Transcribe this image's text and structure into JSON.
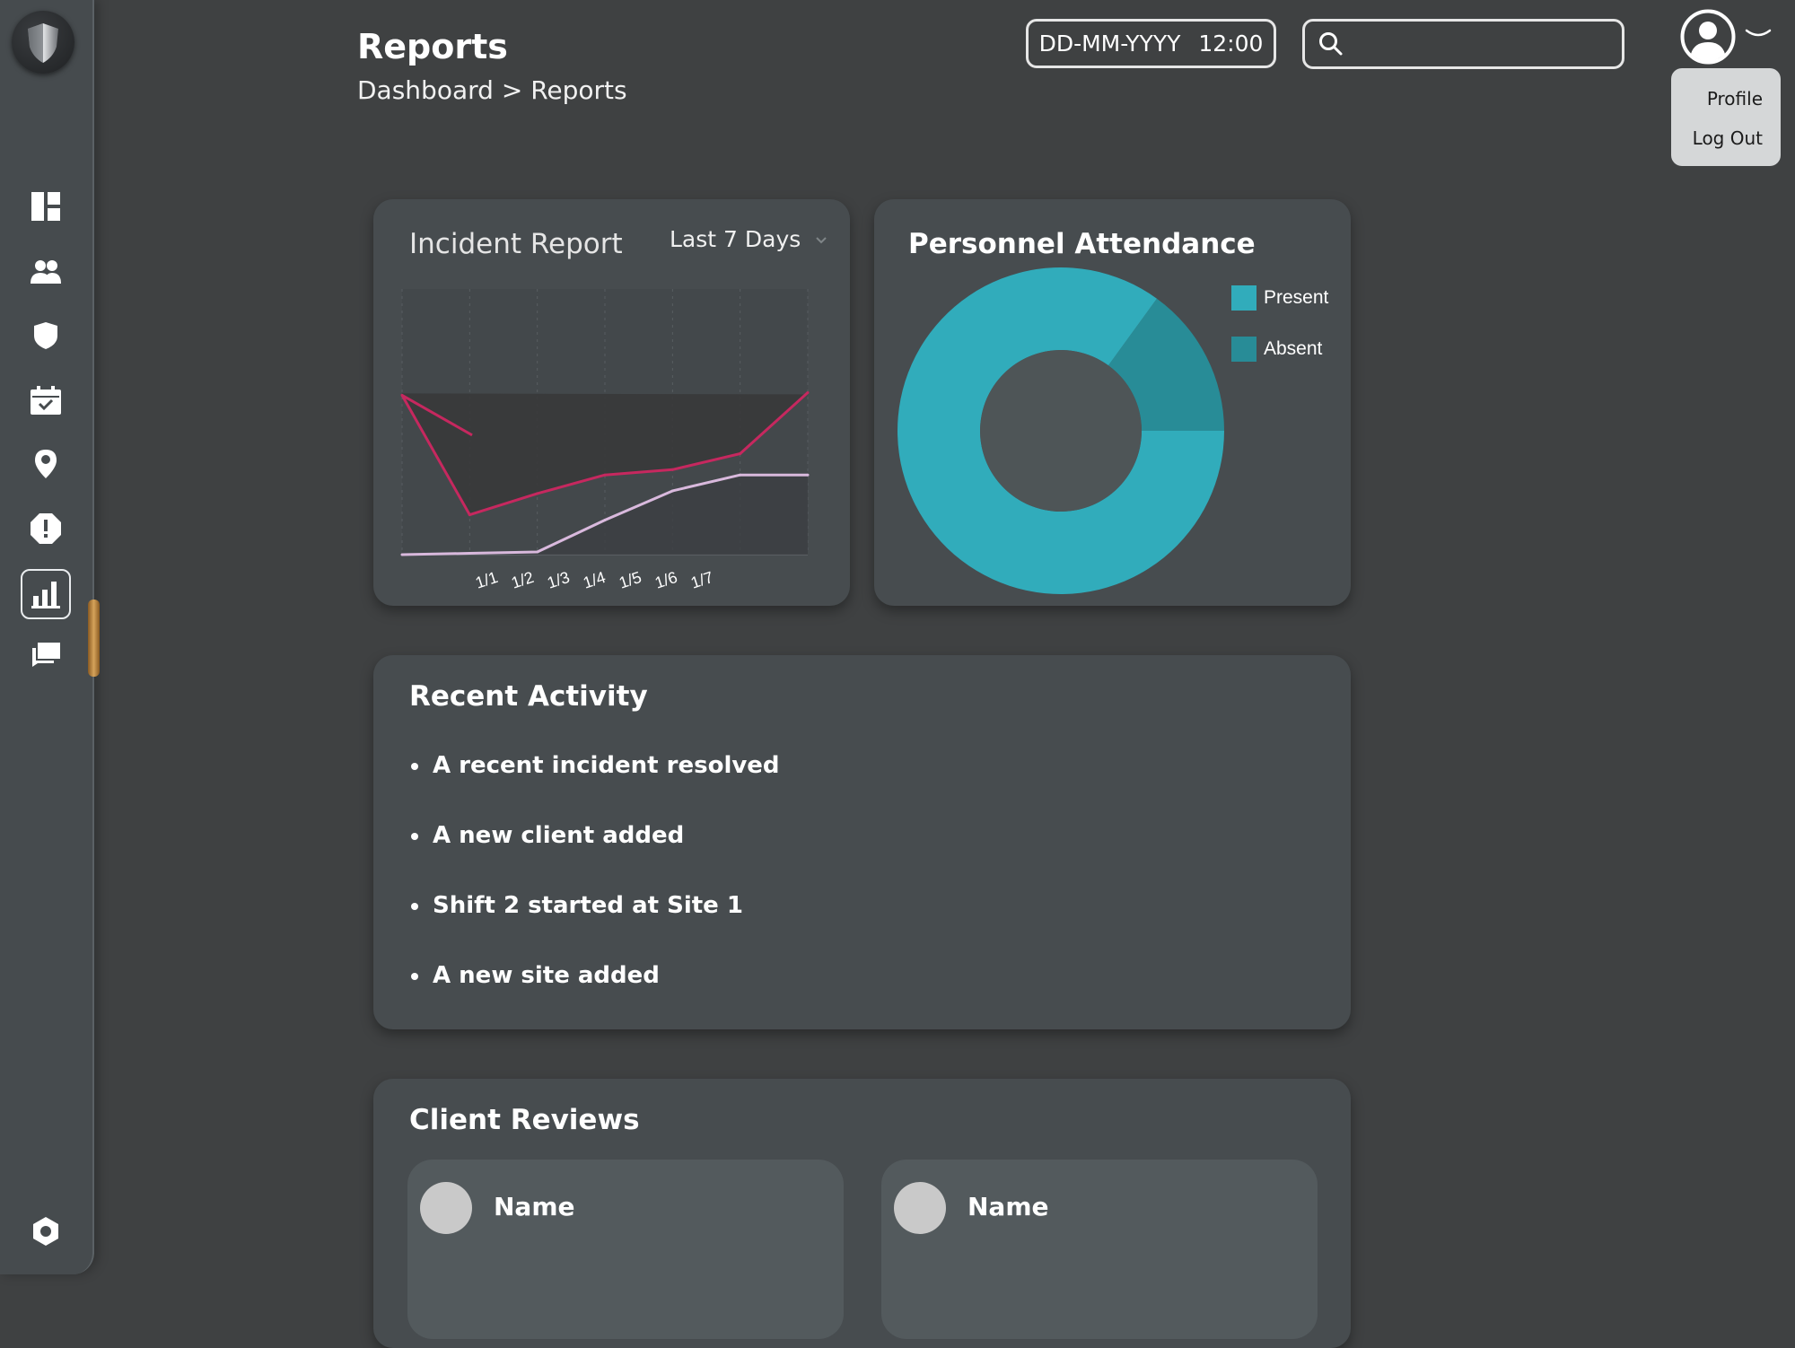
{
  "header": {
    "title": "Reports",
    "breadcrumb": {
      "parent": "Dashboard",
      "separator": ">",
      "current": "Reports"
    },
    "datetime": {
      "date": "DD-MM-YYYY",
      "time": "12:00"
    },
    "search": {
      "placeholder": ""
    }
  },
  "user_menu": {
    "profile": "Profile",
    "logout": "Log Out"
  },
  "sidebar": {
    "items": [
      {
        "icon": "dashboard-icon"
      },
      {
        "icon": "users-icon"
      },
      {
        "icon": "shield-icon"
      },
      {
        "icon": "calendar-check-icon"
      },
      {
        "icon": "location-pin-icon"
      },
      {
        "icon": "alert-icon"
      },
      {
        "icon": "reports-chart-icon",
        "active": true
      },
      {
        "icon": "chat-icon"
      }
    ],
    "settings_icon": "settings-icon"
  },
  "incident_report": {
    "title": "Incident Report",
    "range": "Last 7 Days",
    "range_icon": "chevron-down-icon"
  },
  "attendance": {
    "title": "Personnel Attendance",
    "legend": {
      "present": "Present",
      "absent": "Absent"
    }
  },
  "recent_activity": {
    "title": "Recent Activity",
    "items": [
      "A recent incident resolved",
      "A new client added",
      "Shift 2 started at Site 1",
      "A new site added"
    ]
  },
  "client_reviews": {
    "title": "Client Reviews",
    "reviews": [
      {
        "name": "Name"
      },
      {
        "name": "Name"
      }
    ]
  },
  "colors": {
    "background": "#3f4142",
    "card": "#474c4f",
    "accent_teal": "#31acbb",
    "absent_teal": "#288c97",
    "line_pink": "#c6285f",
    "line_lavender": "#d9b9dd",
    "scroll_thumb": "#c08a44"
  },
  "chart_data": [
    {
      "type": "line",
      "x": [
        "1/1",
        "1/2",
        "1/3",
        "1/4",
        "1/5",
        "1/6",
        "1/7"
      ],
      "series": [
        {
          "values": [
            6.0,
            1.5,
            2.3,
            3.0,
            3.2,
            3.8,
            6.1
          ]
        },
        {
          "values": [
            0.0,
            0.05,
            0.1,
            1.3,
            2.4,
            3.0,
            3.0
          ]
        }
      ],
      "ylim": [
        0,
        10
      ],
      "grid": true
    },
    {
      "type": "pie",
      "labels": [
        "Present",
        "Absent"
      ],
      "values": [
        85,
        15
      ],
      "donut": true
    }
  ]
}
